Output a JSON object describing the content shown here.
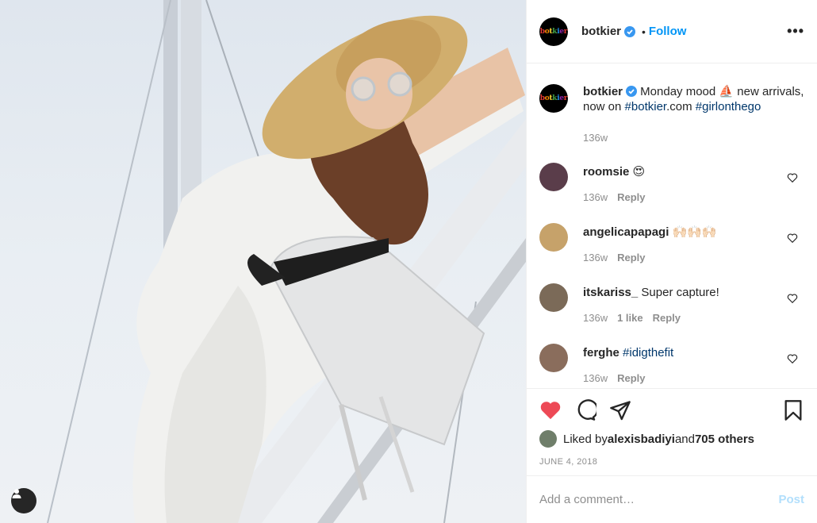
{
  "post": {
    "author": "botkier",
    "follow_label": "Follow",
    "dot": "•",
    "more_label": "•••",
    "logo_text": "botkier",
    "brand_colors": [
      "#e53935",
      "#fb8c00",
      "#fdd835",
      "#43a047",
      "#1e88e5",
      "#8e24aa"
    ]
  },
  "caption": {
    "username": "botkier",
    "text_before": " Monday mood ",
    "emoji": "⛵",
    "text_after": " new arrivals, now on ",
    "tag1": "#botkier",
    "text_mid": ".com ",
    "tag2": "#girlonthego",
    "time": "136w"
  },
  "comments": [
    {
      "username": "roomsie",
      "text": "",
      "emoji": "😍",
      "time": "136w",
      "likes": "",
      "reply": "Reply",
      "avatar_color": "#5a3d4a"
    },
    {
      "username": "angelicapapagi",
      "text": "",
      "emoji": "🙌🏻🙌🏻🙌🏻",
      "time": "136w",
      "likes": "",
      "reply": "Reply",
      "avatar_color": "#c6a26a"
    },
    {
      "username": "itskariss_",
      "text": "Super capture!",
      "emoji": "",
      "time": "136w",
      "likes": "1 like",
      "reply": "Reply",
      "avatar_color": "#7b6a58"
    },
    {
      "username": "ferghe",
      "text": "",
      "tag": "#idigthefit",
      "emoji": "",
      "time": "136w",
      "likes": "",
      "reply": "Reply",
      "avatar_color": "#8a6d5c"
    }
  ],
  "likes": {
    "prefix": "Liked by ",
    "user": "alexisbadiyi",
    "middle": " and ",
    "others": "705 others"
  },
  "date": "JUNE 4, 2018",
  "add_comment": {
    "placeholder": "Add a comment…",
    "post_label": "Post"
  },
  "colors": {
    "like_red": "#ed4956",
    "follow_blue": "#0095f6",
    "verified_blue": "#3897f0",
    "tag_blue": "#00376b"
  }
}
